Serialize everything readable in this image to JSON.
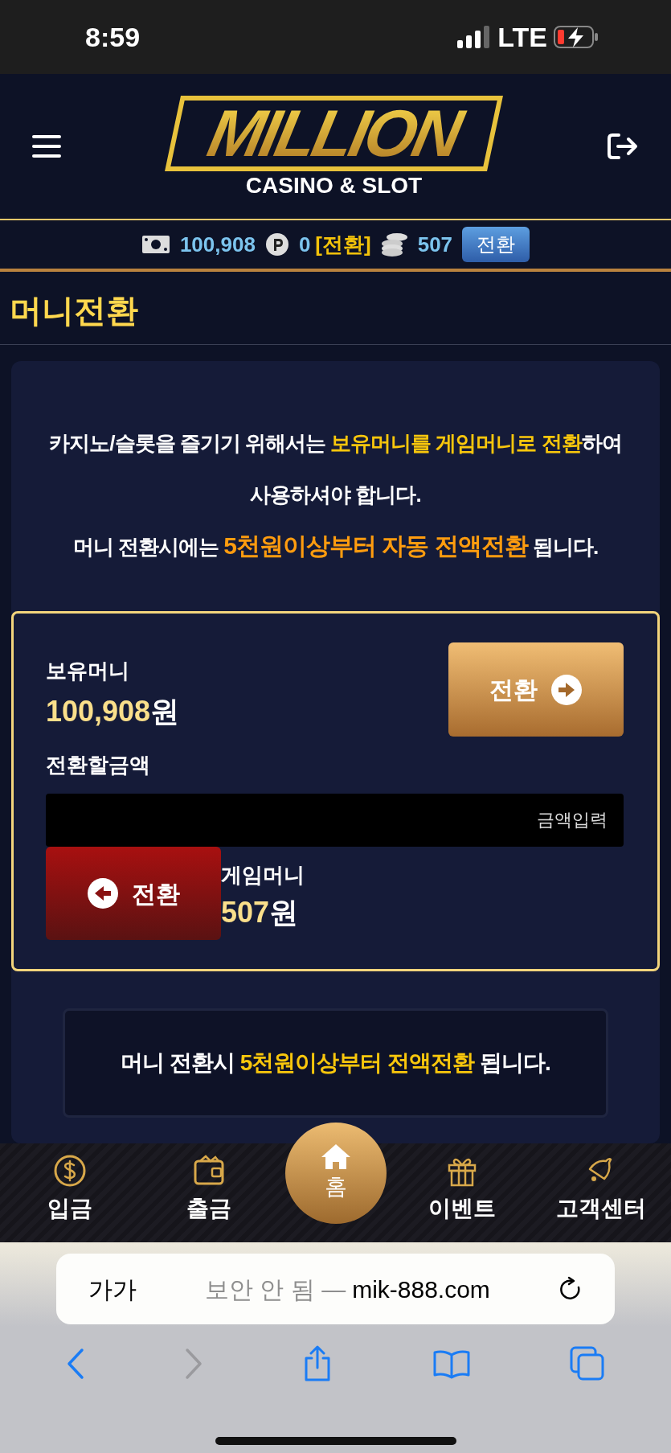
{
  "status_bar": {
    "time": "8:59",
    "network": "LTE"
  },
  "header": {
    "logo_title": "MILLION",
    "logo_subtitle": "CASINO & SLOT"
  },
  "balance_bar": {
    "money": "100,908",
    "points": "0",
    "points_action": "[전환]",
    "game_money": "507",
    "convert_button": "전환"
  },
  "page_title": "머니전환",
  "notice": [
    [
      {
        "text": "카지노/슬롯을 즐기기 위해서는 ",
        "kind": "plain"
      },
      {
        "text": "보유머니를 게임머니로 전환",
        "kind": "highlight"
      },
      {
        "text": "하여 사용하셔야 합니다.",
        "kind": "plain"
      }
    ],
    [
      {
        "text": "머니 전환시에는 ",
        "kind": "plain"
      },
      {
        "text": "5천원이상부터 자동 전액전환",
        "kind": "strong"
      },
      {
        "text": " 됩니다.",
        "kind": "plain"
      }
    ]
  ],
  "transfer": {
    "held_label": "보유머니",
    "held_amount": "100,908",
    "currency": "원",
    "to_game_button": "전환",
    "amount_label": "전환할금액",
    "amount_placeholder": "금액입력",
    "to_held_button": "전환",
    "game_label": "게임머니",
    "game_amount": "507",
    "game_currency": "원"
  },
  "footnote": [
    {
      "text": "머니 전환시 ",
      "kind": "plain"
    },
    {
      "text": "5천원이상부터 전액전환",
      "kind": "highlight"
    },
    {
      "text": " 됩니다.",
      "kind": "plain"
    }
  ],
  "bottom_nav": [
    {
      "label": "입금",
      "kind": "deposit"
    },
    {
      "label": "출금",
      "kind": "withdraw"
    },
    {
      "label": "홈",
      "kind": "home"
    },
    {
      "label": "이벤트",
      "kind": "event"
    },
    {
      "label": "고객센터",
      "kind": "support"
    }
  ],
  "browser": {
    "text_size": "가가",
    "security": "보안 안 됨 —",
    "url": "mik-888.com",
    "back_disabled": false,
    "forward_disabled": true
  }
}
